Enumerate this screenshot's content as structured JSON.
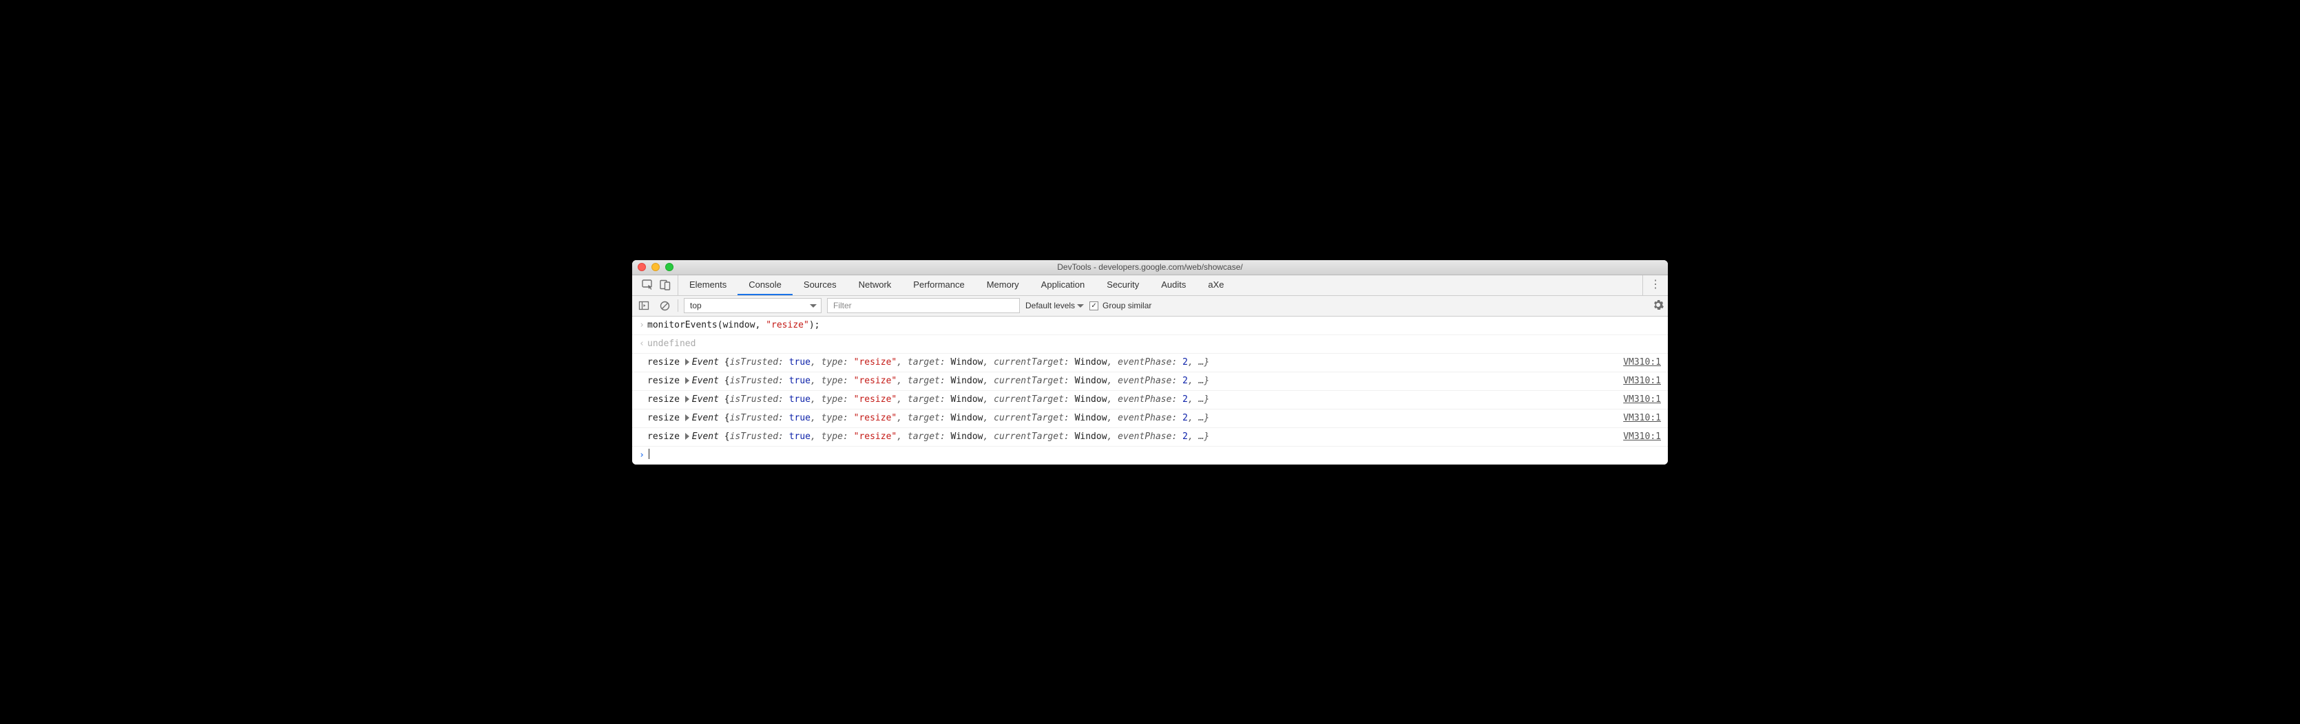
{
  "window": {
    "title": "DevTools - developers.google.com/web/showcase/"
  },
  "tabs": [
    {
      "label": "Elements",
      "active": false
    },
    {
      "label": "Console",
      "active": true
    },
    {
      "label": "Sources",
      "active": false
    },
    {
      "label": "Network",
      "active": false
    },
    {
      "label": "Performance",
      "active": false
    },
    {
      "label": "Memory",
      "active": false
    },
    {
      "label": "Application",
      "active": false
    },
    {
      "label": "Security",
      "active": false
    },
    {
      "label": "Audits",
      "active": false
    },
    {
      "label": "aXe",
      "active": false
    }
  ],
  "toolbar": {
    "context": "top",
    "filter_placeholder": "Filter",
    "levels_label": "Default levels",
    "group_label": "Group similar",
    "group_checked": true
  },
  "console": {
    "input_line": {
      "fn": "monitorEvents",
      "open": "(window, ",
      "str": "\"resize\"",
      "close": ");"
    },
    "return_line": "undefined",
    "events": [
      {
        "name": "resize",
        "type_str": "\"resize\"",
        "source": "VM310:1"
      },
      {
        "name": "resize",
        "type_str": "\"resize\"",
        "source": "VM310:1"
      },
      {
        "name": "resize",
        "type_str": "\"resize\"",
        "source": "VM310:1"
      },
      {
        "name": "resize",
        "type_str": "\"resize\"",
        "source": "VM310:1"
      },
      {
        "name": "resize",
        "type_str": "\"resize\"",
        "source": "VM310:1"
      }
    ],
    "event_template": {
      "obj": "Event",
      "p1k": "isTrusted: ",
      "p1v": "true",
      "p2k": ", type: ",
      "p3k": ", target: ",
      "p3v": "Window",
      "p4k": ", currentTarget: ",
      "p4v": "Window",
      "p5k": ", eventPhase: ",
      "p5v": "2",
      "tail": ", …}"
    }
  }
}
